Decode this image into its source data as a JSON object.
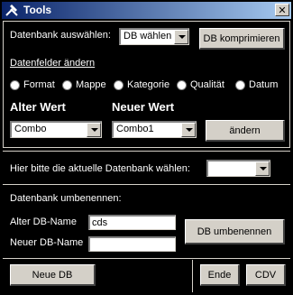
{
  "window": {
    "title": "Tools",
    "close_label": "✕"
  },
  "db_select": {
    "label": "Datenbank auswählen:",
    "combo_value": "DB wählen",
    "compress_button": "DB komprimieren"
  },
  "fields": {
    "section_label": "Datenfelder ändern",
    "options": [
      "Format",
      "Mappe",
      "Kategorie",
      "Qualität",
      "Datum"
    ],
    "old_value_label": "Alter Wert",
    "new_value_label": "Neuer Wert",
    "old_value": "Combo",
    "new_value": "Combo1",
    "change_button": "ändern"
  },
  "current_db": {
    "label": "Hier bitte die aktuelle Datenbank wählen:",
    "value": ""
  },
  "rename": {
    "section_label": "Datenbank umbenennen:",
    "old_name_label": "Alter DB-Name",
    "old_name_value": "cds",
    "new_name_label": "Neuer DB-Name",
    "new_name_value": "",
    "rename_button": "DB umbenennen"
  },
  "footer": {
    "new_db_button": "Neue DB",
    "end_button": "Ende",
    "cdv_button": "CDV"
  }
}
